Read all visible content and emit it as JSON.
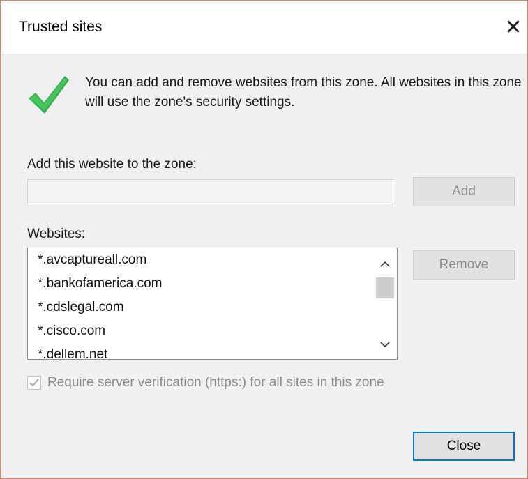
{
  "window": {
    "title": "Trusted sites",
    "close_glyph": "✕"
  },
  "icon": {
    "name": "green-checkmark-icon",
    "color": "#2fb34a"
  },
  "description": "You can add and remove websites from this zone. All websites in this zone will use the zone's security settings.",
  "add_section": {
    "label": "Add this website to the zone:",
    "input_value": "",
    "add_button": "Add"
  },
  "websites_section": {
    "label": "Websites:",
    "items": [
      "*.avcaptureall.com",
      "*.bankofamerica.com",
      "*.cdslegal.com",
      "*.cisco.com",
      "*.dellem.net"
    ],
    "remove_button": "Remove",
    "scroll_up_glyph": "^",
    "scroll_down_glyph": "v"
  },
  "require_verification": {
    "label": "Require server verification (https:) for all sites in this zone",
    "checked": true,
    "enabled": false
  },
  "footer": {
    "close_button": "Close"
  }
}
